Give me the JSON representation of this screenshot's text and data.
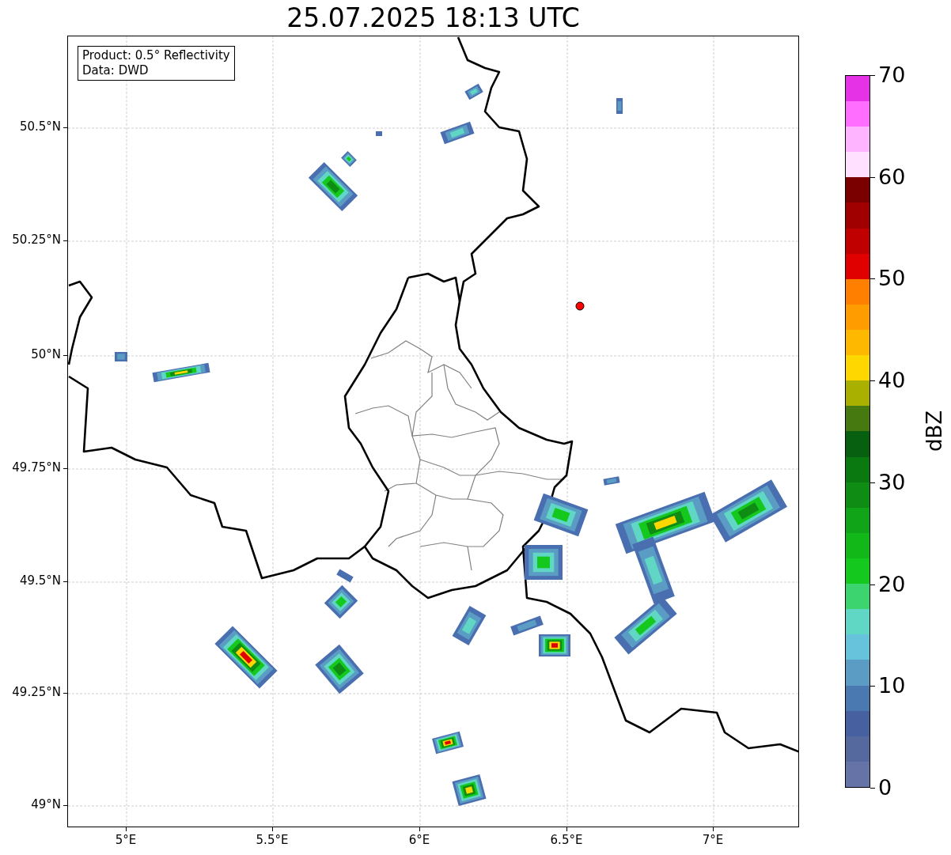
{
  "title": "25.07.2025 18:13 UTC",
  "info_box": [
    "Product: 0.5° Reflectivity",
    "Data: DWD"
  ],
  "y_ticks": [
    "50.5°N",
    "50.25°N",
    "50°N",
    "49.75°N",
    "49.5°N",
    "49.25°N",
    "49°N"
  ],
  "x_ticks": [
    "5°E",
    "5.5°E",
    "6°E",
    "6.5°E",
    "7°E"
  ],
  "colorbar": {
    "label": "dBZ",
    "ticks": [
      "70",
      "60",
      "50",
      "40",
      "30",
      "20",
      "10",
      "0"
    ],
    "segments": [
      {
        "color": "#6673a6"
      },
      {
        "color": "#56699f"
      },
      {
        "color": "#4660a0"
      },
      {
        "color": "#4a78b0"
      },
      {
        "color": "#5b9cc4"
      },
      {
        "color": "#66c3db"
      },
      {
        "color": "#60d6c4"
      },
      {
        "color": "#3cd46f"
      },
      {
        "color": "#14c81e"
      },
      {
        "color": "#12b818"
      },
      {
        "color": "#10a418"
      },
      {
        "color": "#0e8c14"
      },
      {
        "color": "#0a7a10"
      },
      {
        "color": "#066010"
      },
      {
        "color": "#467a10"
      },
      {
        "color": "#aab000"
      },
      {
        "color": "#ffd700"
      },
      {
        "color": "#ffb800"
      },
      {
        "color": "#ff9c00"
      },
      {
        "color": "#ff7f00"
      },
      {
        "color": "#e00000"
      },
      {
        "color": "#c00000"
      },
      {
        "color": "#a00000"
      },
      {
        "color": "#7a0000"
      },
      {
        "color": "#ffe0ff"
      },
      {
        "color": "#ffb4ff"
      },
      {
        "color": "#ff6eff"
      },
      {
        "color": "#e632e6"
      }
    ]
  }
}
